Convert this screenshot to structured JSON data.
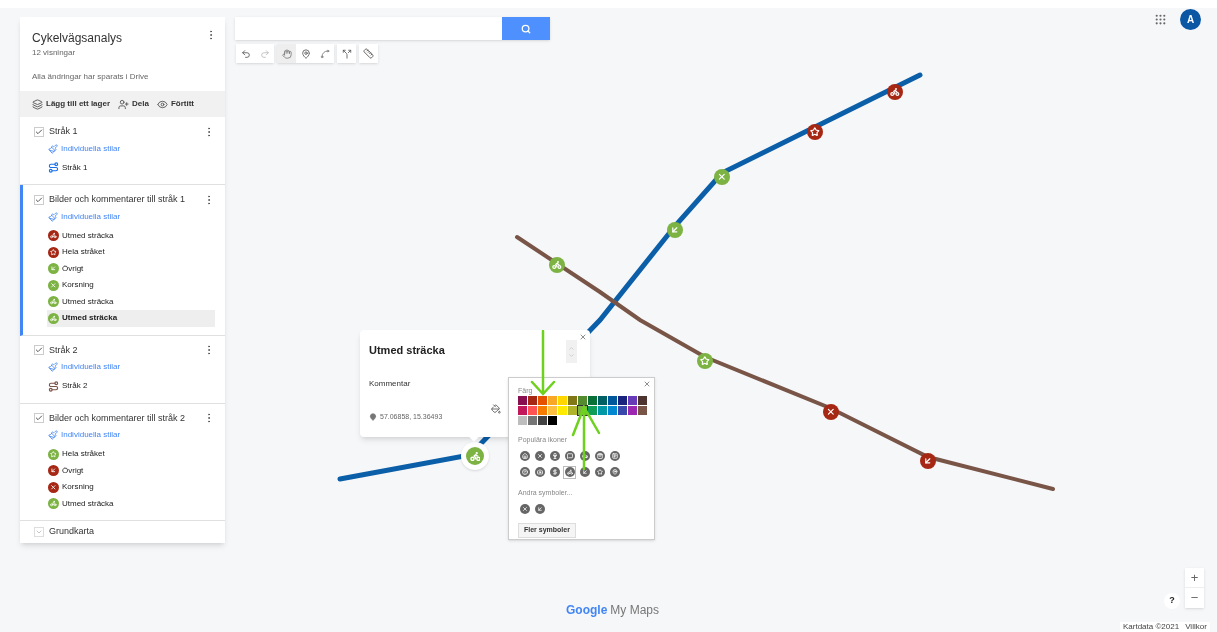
{
  "map": {
    "title": "Cykelvägsanalys",
    "views": "12 visningar",
    "save_status": "Alla ändringar har sparats i Drive"
  },
  "actions": [
    {
      "kind": "layer",
      "label": "Lägg till ett lager"
    },
    {
      "kind": "share",
      "label": "Dela"
    },
    {
      "kind": "preview",
      "label": "Förtitt"
    }
  ],
  "layers": [
    {
      "title": "Stråk 1",
      "checked": true,
      "selected": false,
      "style_link": "Individuella stilar",
      "items": [
        {
          "kind": "line",
          "label": "Stråk 1",
          "color": "#1a73e8",
          "selected": false
        }
      ]
    },
    {
      "title": "Bilder och kommentarer till stråk 1",
      "checked": true,
      "selected": true,
      "style_link": "Individuella stilar",
      "items": [
        {
          "kind": "bike",
          "label": "Utmed sträcka",
          "color": "#a52714",
          "selected": false
        },
        {
          "kind": "star",
          "label": "Hela stråket",
          "color": "#a52714",
          "selected": false
        },
        {
          "kind": "arrow",
          "label": "Övrigt",
          "color": "#7cb342",
          "selected": false
        },
        {
          "kind": "cross",
          "label": "Korsning",
          "color": "#7cb342",
          "selected": false
        },
        {
          "kind": "bike",
          "label": "Utmed sträcka",
          "color": "#7cb342",
          "selected": false
        },
        {
          "kind": "bike",
          "label": "Utmed sträcka",
          "color": "#7cb342",
          "selected": true
        }
      ]
    },
    {
      "title": "Stråk 2",
      "checked": true,
      "selected": false,
      "style_link": "Individuella stilar",
      "items": [
        {
          "kind": "line",
          "label": "Stråk 2",
          "color": "#795548",
          "selected": false
        }
      ]
    },
    {
      "title": "Bilder och kommentarer till stråk 2",
      "checked": true,
      "selected": false,
      "style_link": "Individuella stilar",
      "items": [
        {
          "kind": "star",
          "label": "Hela stråket",
          "color": "#7cb342",
          "selected": false
        },
        {
          "kind": "arrow",
          "label": "Övrigt",
          "color": "#a52714",
          "selected": false
        },
        {
          "kind": "cross",
          "label": "Korsning",
          "color": "#a52714",
          "selected": false
        },
        {
          "kind": "bike",
          "label": "Utmed sträcka",
          "color": "#7cb342",
          "selected": false
        }
      ]
    }
  ],
  "base_map": {
    "label": "Grundkarta",
    "expanded": false
  },
  "account": {
    "initial": "A"
  },
  "info_window": {
    "title": "Utmed sträcka",
    "description": "Kommentar",
    "coordinates": "57.06858, 15.36493"
  },
  "style_popup": {
    "color_label": "Färg",
    "colors": [
      {
        "color": "#880e4f",
        "selected": false
      },
      {
        "color": "#a52714",
        "selected": false
      },
      {
        "color": "#e65100",
        "selected": false
      },
      {
        "color": "#f9a825",
        "selected": false
      },
      {
        "color": "#ffd600",
        "selected": false
      },
      {
        "color": "#817717",
        "selected": false
      },
      {
        "color": "#558b2f",
        "selected": false
      },
      {
        "color": "#097138",
        "selected": false
      },
      {
        "color": "#006064",
        "selected": false
      },
      {
        "color": "#01579b",
        "selected": false
      },
      {
        "color": "#1a237e",
        "selected": false
      },
      {
        "color": "#673ab7",
        "selected": false
      },
      {
        "color": "#4e342e",
        "selected": false
      },
      {
        "color": "#c2185b",
        "selected": false
      },
      {
        "color": "#ff5252",
        "selected": false
      },
      {
        "color": "#f57c00",
        "selected": false
      },
      {
        "color": "#ffbf40",
        "selected": false
      },
      {
        "color": "#ffea00",
        "selected": false
      },
      {
        "color": "#afb42b",
        "selected": false
      },
      {
        "color": "#7cb342",
        "selected": true
      },
      {
        "color": "#0f9d58",
        "selected": false
      },
      {
        "color": "#0097a7",
        "selected": false
      },
      {
        "color": "#0288d1",
        "selected": false
      },
      {
        "color": "#3949ab",
        "selected": false
      },
      {
        "color": "#9c27b0",
        "selected": false
      },
      {
        "color": "#795548",
        "selected": false
      },
      {
        "color": "#bdbdbd",
        "selected": false
      },
      {
        "color": "#757575",
        "selected": false
      },
      {
        "color": "#424242",
        "selected": false
      },
      {
        "color": "#000000",
        "selected": false
      }
    ],
    "popular_label": "Populära ikoner",
    "popular_icons": [
      {
        "kind": "home",
        "selected": false
      },
      {
        "kind": "cross",
        "selected": false
      },
      {
        "kind": "glass",
        "selected": false
      },
      {
        "kind": "chat",
        "selected": false
      },
      {
        "kind": "car",
        "selected": false
      },
      {
        "kind": "bag",
        "selected": false
      },
      {
        "kind": "parking",
        "selected": false
      },
      {
        "kind": "help",
        "selected": false
      },
      {
        "kind": "camera",
        "selected": false
      },
      {
        "kind": "dollar",
        "selected": false
      },
      {
        "kind": "bike",
        "selected": true
      },
      {
        "kind": "arrow",
        "selected": false
      },
      {
        "kind": "star",
        "selected": false
      },
      {
        "kind": "pin",
        "selected": false
      }
    ],
    "other_label": "Andra symboler...",
    "other_icons": [
      {
        "kind": "cross",
        "selected": false
      },
      {
        "kind": "arrow",
        "selected": false
      }
    ],
    "more_button": "Fler symboler"
  },
  "footer": {
    "logo_google": "Google",
    "logo_product": "My Maps",
    "help": "?",
    "zoom_in": "+",
    "zoom_out": "−",
    "map_data": "Kartdata ©2021",
    "terms": "Villkor"
  }
}
